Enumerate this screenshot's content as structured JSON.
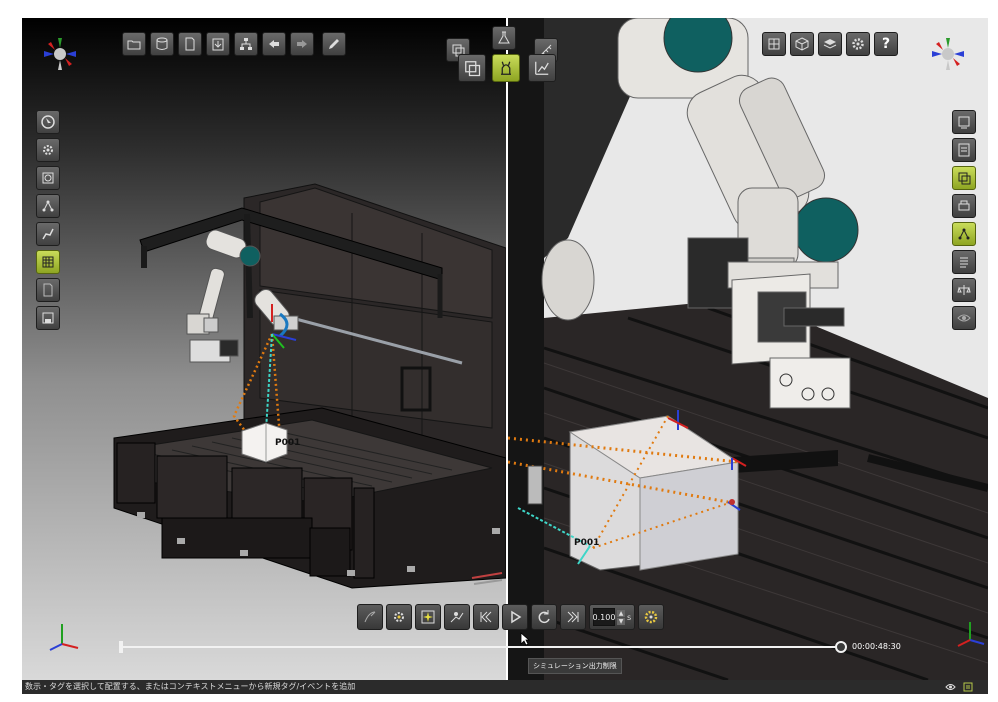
{
  "viewport_left": {
    "tag_label": "P001",
    "left_toolbar": [
      "select-arrow-icon",
      "robot-settings-icon",
      "target-icon",
      "tag-points-icon",
      "robot-path-icon",
      "grid-table-icon",
      "document-icon",
      "save-icon"
    ],
    "left_toolbar_active": "grid-table-icon"
  },
  "viewport_right": {
    "tag_label": "P001",
    "right_toolbar": [
      "display-icon",
      "report-icon",
      "copy-layers-icon",
      "print-icon",
      "tag-points-icon",
      "list-icon",
      "balance-icon",
      "visibility-icon"
    ],
    "right_toolbar_active": [
      "copy-layers-icon",
      "tag-points-icon"
    ]
  },
  "top_toolbar": {
    "file_buttons": [
      "open-folder-icon",
      "database-icon",
      "document-icon",
      "import-icon",
      "hierarchy-icon",
      "arrow-left-icon",
      "arrow-right-icon",
      "pencil-icon"
    ],
    "mode_buttons": [
      "copy-icon",
      "flask-icon",
      "ruler-icon"
    ],
    "mode_buttons_secondary": [
      "copy-square-icon",
      "simulation-mode-icon",
      "chart-icon"
    ],
    "mode_active": "simulation-mode-icon",
    "view_buttons": [
      "layout-grid-icon",
      "cube-view-icon",
      "layers-icon",
      "gear-icon"
    ],
    "help_label": "?"
  },
  "simulation": {
    "controls": [
      "pen-tool-icon",
      "robot-target-icon",
      "collision-icon",
      "path-step-icon",
      "skip-back-icon",
      "play-icon",
      "loop-icon",
      "skip-forward-icon"
    ],
    "step_value": "0.100",
    "step_unit": "s",
    "timeline_progress": 1.0,
    "time": "00:00:48:30",
    "tooltip": "シミュレーション出力制限"
  },
  "statusbar": {
    "message": "数示・タグを選択して配置する、またはコンテキストメニューから新規タグ/イベントを追加"
  },
  "colors": {
    "active_button": "#b5c94a",
    "tag_red": "#d42020",
    "tag_blue": "#2a3fd6",
    "path_orange": "#e07a10",
    "path_cyan": "#3ed6c8",
    "robot_teal": "#0f6060"
  }
}
